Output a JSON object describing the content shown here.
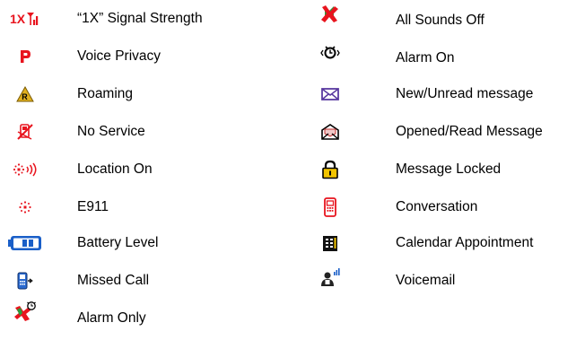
{
  "left_items": [
    {
      "icon": "1x-signal-strength-icon",
      "label": "“1X” Signal Strength"
    },
    {
      "icon": "voice-privacy-icon",
      "label": "Voice Privacy"
    },
    {
      "icon": "roaming-icon",
      "label": "Roaming"
    },
    {
      "icon": "no-service-icon",
      "label": "No Service"
    },
    {
      "icon": "location-on-icon",
      "label": "Location On"
    },
    {
      "icon": "e911-icon",
      "label": "E911"
    },
    {
      "icon": "battery-level-icon",
      "label": "Battery Level"
    },
    {
      "icon": "missed-call-icon",
      "label": "Missed Call"
    },
    {
      "icon": "alarm-only-icon",
      "label": "Alarm Only"
    }
  ],
  "right_items": [
    {
      "icon": "all-sounds-off-icon",
      "label": "All Sounds Off"
    },
    {
      "icon": "alarm-on-icon",
      "label": "Alarm On"
    },
    {
      "icon": "new-unread-message-icon",
      "label": "New/Unread message"
    },
    {
      "icon": "opened-read-message-icon",
      "label": "Opened/Read Message"
    },
    {
      "icon": "message-locked-icon",
      "label": "Message Locked"
    },
    {
      "icon": "conversation-icon",
      "label": "Conversation"
    },
    {
      "icon": "calendar-appointment-icon",
      "label": "Calendar Appointment"
    },
    {
      "icon": "voicemail-icon",
      "label": "Voicemail"
    }
  ],
  "colors": {
    "red": "#e8141e",
    "purple": "#5a3aa0",
    "blue": "#1a5fc8",
    "gold": "#e0b020",
    "green": "#2a9a3a"
  }
}
